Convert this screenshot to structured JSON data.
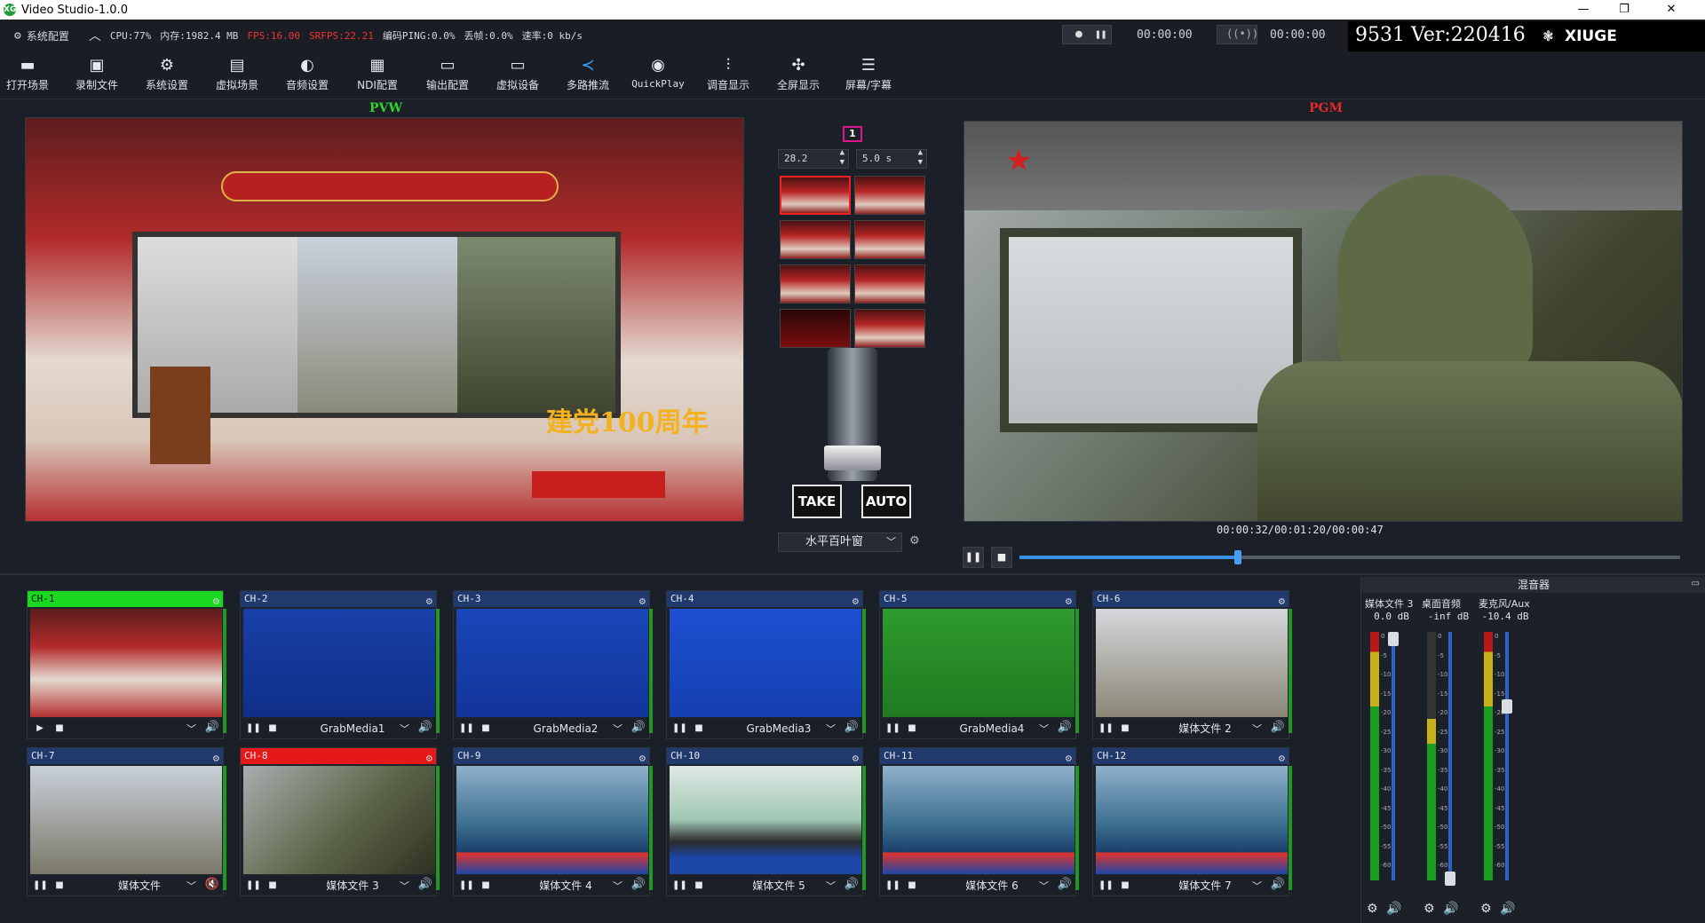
{
  "window": {
    "title": "Video Studio-1.0.0",
    "logo": "XG"
  },
  "status": {
    "settings_label": "系统配置",
    "cpu": "CPU:77%",
    "memory": "内存:1982.4 MB",
    "fps": "FPS:16.00",
    "srfps": "SRFPS:22.21",
    "encode_ping": "编码PING:0.0%",
    "drop": "丢帧:0.0%",
    "rate": "速率:0 kb/s",
    "rec_time": "00:00:00",
    "live_time": "00:00:00",
    "version": "9531 Ver:220416",
    "brand": "XIUGE"
  },
  "toolbar": [
    {
      "label": "打开场景",
      "icon": "open-scene-icon",
      "glyph": "▬"
    },
    {
      "label": "录制文件",
      "icon": "record-file-icon",
      "glyph": "▣"
    },
    {
      "label": "系统设置",
      "icon": "gear-icon",
      "glyph": "⚙"
    },
    {
      "label": "虚拟场景",
      "icon": "virtual-scene-icon",
      "glyph": "▤"
    },
    {
      "label": "音频设置",
      "icon": "audio-icon",
      "glyph": "◐"
    },
    {
      "label": "NDI配置",
      "icon": "ndi-icon",
      "glyph": "▦"
    },
    {
      "label": "输出配置",
      "icon": "save-icon",
      "glyph": "▭"
    },
    {
      "label": "虚拟设备",
      "icon": "monitor-icon",
      "glyph": "▭"
    },
    {
      "label": "多路推流",
      "icon": "stream-icon",
      "glyph": "≺"
    },
    {
      "label": "QuickPlay",
      "icon": "quickplay-icon",
      "glyph": "◉"
    },
    {
      "label": "调音显示",
      "icon": "mixer-icon",
      "glyph": "⫶"
    },
    {
      "label": "全屏显示",
      "icon": "fullscreen-icon",
      "glyph": "✣"
    },
    {
      "label": "屏幕/字幕",
      "icon": "subtitle-icon",
      "glyph": "☰"
    }
  ],
  "preview": {
    "label": "PVW",
    "caption": "建党100周年"
  },
  "program": {
    "label": "PGM"
  },
  "transition": {
    "badge": "1",
    "value1": "28.2",
    "value2": "5.0 s",
    "take": "TAKE",
    "auto": "AUTO",
    "effect": "水平百叶窗"
  },
  "playback": {
    "timecode": "00:00:32/00:01:20/00:00:47",
    "progress": 0.33
  },
  "channels": [
    {
      "id": "CH-1",
      "source": "",
      "state": "preview",
      "scene": "studio"
    },
    {
      "id": "CH-2",
      "source": "GrabMedia1",
      "state": "",
      "scene": "blue-anchor"
    },
    {
      "id": "CH-3",
      "source": "GrabMedia2",
      "state": "",
      "scene": "blue-walk"
    },
    {
      "id": "CH-4",
      "source": "GrabMedia3",
      "state": "",
      "scene": "blue-woman"
    },
    {
      "id": "CH-5",
      "source": "GrabMedia4",
      "state": "",
      "scene": "green"
    },
    {
      "id": "CH-6",
      "source": "媒体文件 2",
      "state": "",
      "scene": "rocket"
    },
    {
      "id": "CH-7",
      "source": "媒体文件",
      "state": "",
      "scene": "rockets"
    },
    {
      "id": "CH-8",
      "source": "媒体文件 3",
      "state": "program",
      "scene": "soldier"
    },
    {
      "id": "CH-9",
      "source": "媒体文件 4",
      "state": "",
      "scene": "news"
    },
    {
      "id": "CH-10",
      "source": "媒体文件 5",
      "state": "",
      "scene": "news-anchor"
    },
    {
      "id": "CH-11",
      "source": "媒体文件 6",
      "state": "",
      "scene": "news"
    },
    {
      "id": "CH-12",
      "source": "媒体文件 7",
      "state": "",
      "scene": "news"
    }
  ],
  "mixer": {
    "title": "混音器",
    "channels": [
      {
        "name": "媒体文件 3",
        "db": "0.0 dB",
        "level": 1.0
      },
      {
        "name": "桌面音频",
        "db": "-inf dB",
        "level": 0.0
      },
      {
        "name": "麦克风/Aux",
        "db": "-10.4 dB",
        "level": 0.72
      }
    ],
    "scale": [
      "0",
      "-5",
      "-10",
      "-15",
      "-20",
      "-25",
      "-30",
      "-35",
      "-40",
      "-45",
      "-50",
      "-55",
      "-60"
    ]
  },
  "colors": {
    "preview": "#19d81f",
    "program": "#e51919",
    "accent": "#3b8fe0"
  }
}
